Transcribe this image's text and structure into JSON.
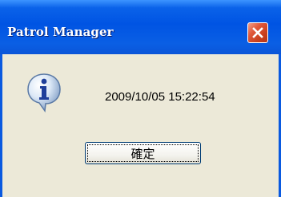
{
  "dialog": {
    "title": "Patrol Manager",
    "message": "2009/10/05 15:22:54",
    "ok_label": "確定",
    "icon": "information-icon",
    "close_icon": "close-icon"
  },
  "colors": {
    "titlebar": "#0054e3",
    "close_button": "#e0583a",
    "dialog_background": "#ece9d8"
  }
}
